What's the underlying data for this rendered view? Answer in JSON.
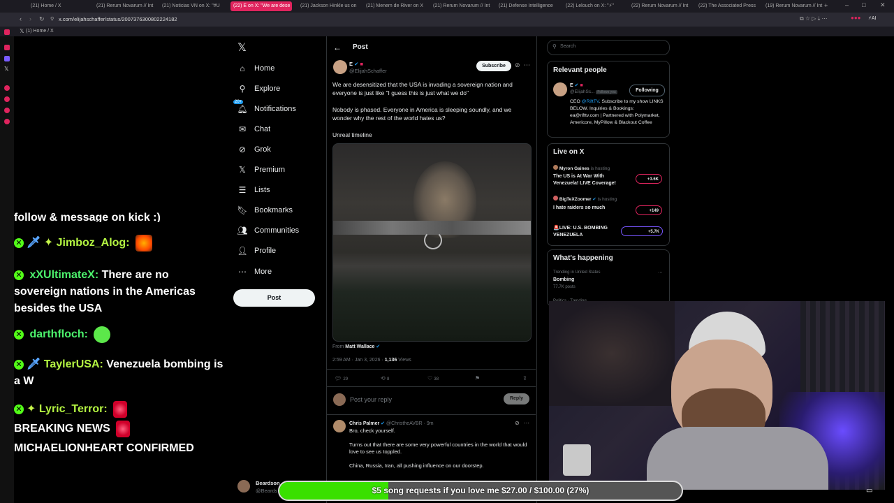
{
  "browser": {
    "tabs": [
      "(21) Home / X",
      "(21) Rerum Novarum // Int",
      "(21) Noticias VN on X: \"#U",
      "(22) E on X: \"We are dese",
      "(21) Jackson Hinkle us on",
      "(21) Menem de River on X",
      "(21) Rerum Novarum // Int",
      "(21) Defense Intelligence",
      "(22) Lelouch on X: \"⚡\"",
      "(22) Rerum Novarum // Int",
      "(22) The Associated Press",
      "(19) Rerum Novarum // Int"
    ],
    "url": "x.com/elijahschaffer/status/2007376300802224182",
    "bookmark": "(1) Home / X"
  },
  "chat": {
    "line0": "follow & message on kick :)",
    "m1_user": "Jimboz_Alog:",
    "m2_user": "xXUltimateX:",
    "m2_text": "There are no sovereign nations in the Americas besides the USA",
    "m3_user": "darthfloch:",
    "m4_user": "TaylerUSA:",
    "m4_text": "Venezuela bombing is a W",
    "m5_user": "Lyric_Terror:",
    "m5_text1": "BREAKING NEWS",
    "m5_text2": "MICHAELIONHEART CONFIRMED"
  },
  "nav": {
    "home": "Home",
    "explore": "Explore",
    "notifications": "Notifications",
    "notif_badge": "20+",
    "chat": "Chat",
    "grok": "Grok",
    "premium": "Premium",
    "lists": "Lists",
    "bookmarks": "Bookmarks",
    "communities": "Communities",
    "profile": "Profile",
    "more": "More",
    "post": "Post"
  },
  "post": {
    "header": "Post",
    "author": "E",
    "handle": "@ElijahSchaffer",
    "subscribe": "Subscribe",
    "text1": "We are desensitized that the USA is invading a sovereign nation and everyone is just like \"I guess this is just what we do\"",
    "text2": "Nobody is phased. Everyone in America is sleeping soundly, and we wonder why the rest of the world hates us?",
    "text3": "Unreal timeline",
    "from_label": "From",
    "from_name": "Matt Wallace",
    "time": "2:59 AM · Jan 3, 2026 ·",
    "views": "1,136",
    "views_label": "Views",
    "replies": "29",
    "reposts": "8",
    "likes": "38",
    "reply_placeholder": "Post your reply",
    "reply_button": "Reply"
  },
  "reply": {
    "author": "Chris Palmer",
    "handle": "@ChristheAVBR · 9m",
    "line1": "Bro, check yourself.",
    "line2": "Turns out that there are some very powerful countries in the world that would love to see us toppled.",
    "line3": "China, Russia, Iran, all pushing influence on our doorstep."
  },
  "bottom_account": {
    "name": "Beardson",
    "handle": "@Beards"
  },
  "right": {
    "search_placeholder": "Search",
    "relevant_title": "Relevant people",
    "person_name": "E",
    "person_handle": "@ElijahSc...",
    "follows_you": "Follows you",
    "following": "Following",
    "person_bio_pre": "CEO",
    "person_bio_link": "@RiftTV",
    "person_bio": ". Subscribe to my show LINKS BELOW. Inquiries & Bookings: ea@rifttv.com | Partnered with Polymarket, Americore, MyPillow & Blackout Coffee",
    "live_title": "Live on X",
    "live1_host": "Myron Gaines",
    "live1_hosting": "is hosting",
    "live1_title": "The US is At War With Venezuela! LIVE Coverage!",
    "live1_count": "+3.6K",
    "live2_host": "BigTeXZoomer",
    "live2_hosting": "is hosting",
    "live2_title": "I hate raiders so much",
    "live2_count": "+149",
    "live3_title": "🚨LIVE: U.S. BOMBING VENEZUELA",
    "live3_count": "+5.7K",
    "happening_title": "What's happening",
    "trend_context": "Trending in United States",
    "trend_name": "Bombing",
    "trend_posts": "77.7K posts",
    "trend2_context": "Politics · Trending"
  },
  "goal": {
    "text": "$5 song requests if you love me $27.00 / $100.00 (27%)",
    "progress": 0.27
  },
  "colors": {
    "accent": "#1d9bf0",
    "kick_green": "#53fc18",
    "tab_active": "#e0245e"
  }
}
